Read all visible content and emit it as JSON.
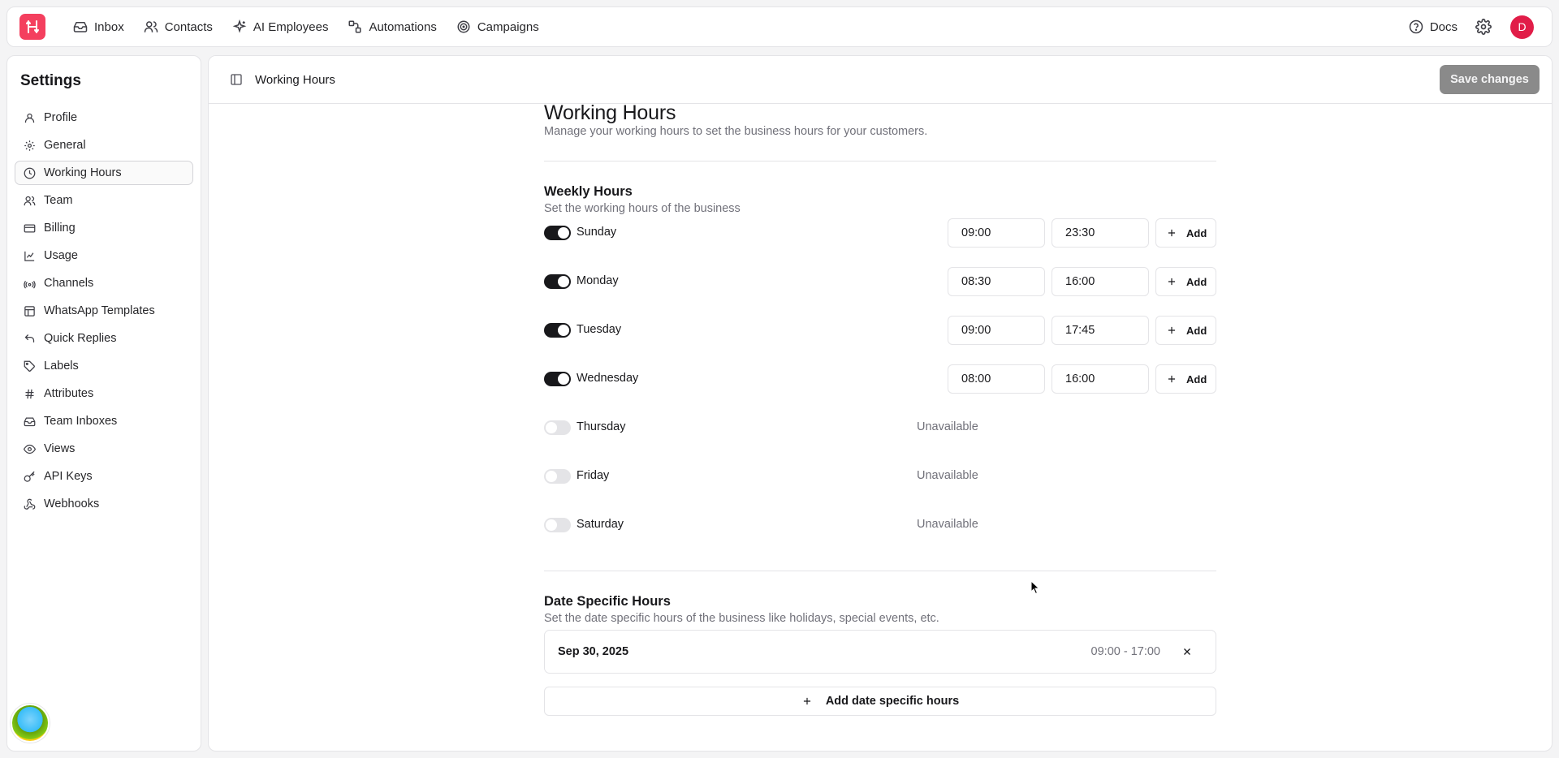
{
  "topbar": {
    "nav": [
      {
        "label": "Inbox",
        "icon": "inbox-icon"
      },
      {
        "label": "Contacts",
        "icon": "contacts-icon"
      },
      {
        "label": "AI Employees",
        "icon": "sparkle-icon"
      },
      {
        "label": "Automations",
        "icon": "automation-icon"
      },
      {
        "label": "Campaigns",
        "icon": "target-icon"
      }
    ],
    "docs_label": "Docs",
    "avatar_initial": "D",
    "brand_color": "#f43f5e"
  },
  "sidebar": {
    "title": "Settings",
    "items": [
      {
        "label": "Profile",
        "icon": "user-icon"
      },
      {
        "label": "General",
        "icon": "gear-icon"
      },
      {
        "label": "Working Hours",
        "icon": "clock-icon",
        "active": true
      },
      {
        "label": "Team",
        "icon": "team-icon"
      },
      {
        "label": "Billing",
        "icon": "card-icon"
      },
      {
        "label": "Usage",
        "icon": "chart-icon"
      },
      {
        "label": "Channels",
        "icon": "broadcast-icon"
      },
      {
        "label": "WhatsApp Templates",
        "icon": "template-icon"
      },
      {
        "label": "Quick Replies",
        "icon": "reply-icon"
      },
      {
        "label": "Labels",
        "icon": "tag-icon"
      },
      {
        "label": "Attributes",
        "icon": "hash-icon"
      },
      {
        "label": "Team Inboxes",
        "icon": "inbox-icon"
      },
      {
        "label": "Views",
        "icon": "eye-icon"
      },
      {
        "label": "API Keys",
        "icon": "key-icon"
      },
      {
        "label": "Webhooks",
        "icon": "webhook-icon"
      }
    ]
  },
  "header": {
    "title": "Working Hours",
    "save_label": "Save changes"
  },
  "page": {
    "title": "Working Hours",
    "subtitle": "Manage your working hours to set the business hours for your customers."
  },
  "weekly": {
    "title": "Weekly Hours",
    "subtitle": "Set the working hours of the business",
    "add_label": "Add",
    "unavailable_label": "Unavailable",
    "days": [
      {
        "name": "Sunday",
        "enabled": true,
        "start": "09:00",
        "end": "23:30"
      },
      {
        "name": "Monday",
        "enabled": true,
        "start": "08:30",
        "end": "16:00"
      },
      {
        "name": "Tuesday",
        "enabled": true,
        "start": "09:00",
        "end": "17:45"
      },
      {
        "name": "Wednesday",
        "enabled": true,
        "start": "08:00",
        "end": "16:00"
      },
      {
        "name": "Thursday",
        "enabled": false
      },
      {
        "name": "Friday",
        "enabled": false
      },
      {
        "name": "Saturday",
        "enabled": false
      }
    ]
  },
  "date_specific": {
    "title": "Date Specific Hours",
    "subtitle": "Set the date specific hours of the business like holidays, special events, etc.",
    "entries": [
      {
        "date": "Sep 30, 2025",
        "range": "09:00 - 17:00"
      }
    ],
    "add_label": "Add date specific hours"
  }
}
